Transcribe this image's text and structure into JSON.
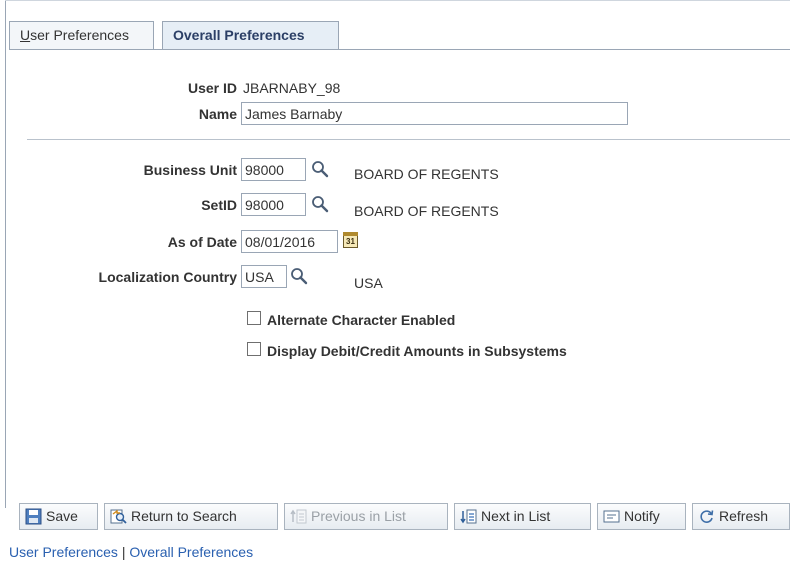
{
  "tabs": {
    "user_preferences_underlined": "U",
    "user_preferences_rest": "ser Preferences",
    "overall_preferences": "Overall Preferences"
  },
  "user": {
    "user_id_label": "User ID",
    "user_id_value": "JBARNABY_98",
    "name_label": "Name",
    "name_value": "James Barnaby"
  },
  "fields": {
    "business_unit_label": "Business Unit",
    "business_unit_value": "98000",
    "business_unit_descr": "BOARD OF REGENTS",
    "setid_label": "SetID",
    "setid_value": "98000",
    "setid_descr": "BOARD OF REGENTS",
    "as_of_date_label": "As of Date",
    "as_of_date_value": "08/01/2016",
    "localization_country_label": "Localization Country",
    "localization_country_value": "USA",
    "localization_country_descr": "USA"
  },
  "checkboxes": {
    "alternate_character_label": "Alternate Character Enabled",
    "alternate_character_checked": false,
    "debit_credit_label": "Display Debit/Credit Amounts in Subsystems",
    "debit_credit_checked": false
  },
  "calendar_icon_text": "31",
  "toolbar": {
    "save": "Save",
    "return_to_search": "Return to Search",
    "previous_in_list": "Previous in List",
    "next_in_list": "Next in List",
    "notify": "Notify",
    "refresh": "Refresh"
  },
  "bottom_links": {
    "user_preferences": "User Preferences",
    "separator": "|",
    "overall_preferences": "Overall Preferences"
  },
  "colors": {
    "link": "#2a60b0",
    "tab_active_text": "#2b3f66",
    "border": "#9aa6b5"
  }
}
